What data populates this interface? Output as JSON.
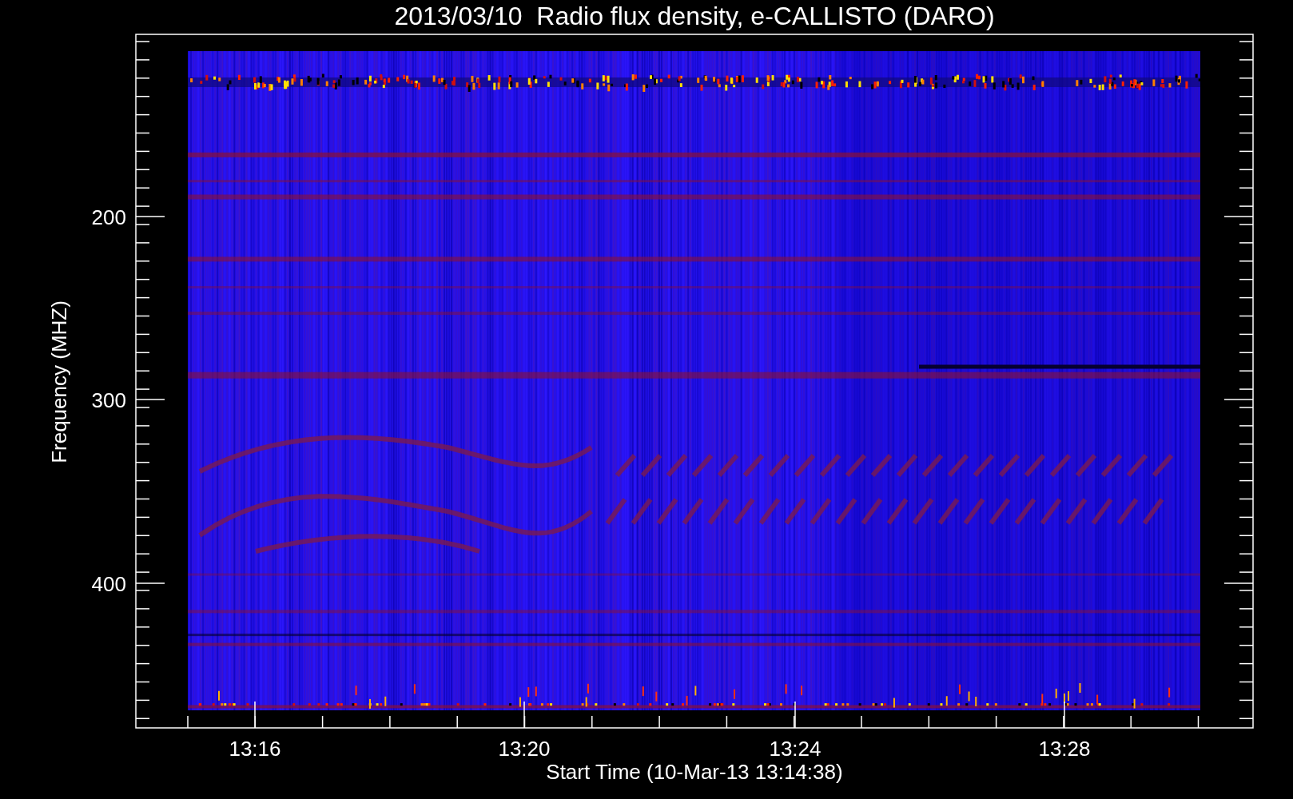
{
  "title": "2013/03/10  Radio flux density, e-CALLISTO (DARO)",
  "y_axis": {
    "label": "Frequency (MHZ)",
    "ticks": [
      "200",
      "300",
      "400"
    ]
  },
  "x_axis": {
    "label": "Start Time (10-Mar-13 13:14:38)",
    "ticks": [
      "13:16",
      "13:20",
      "13:24",
      "13:28"
    ]
  }
}
